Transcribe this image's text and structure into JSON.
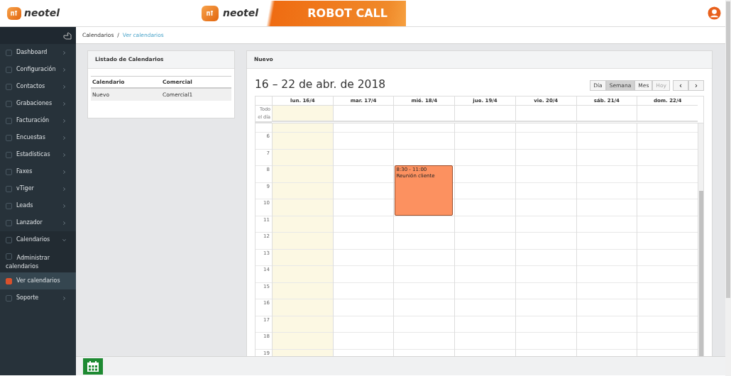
{
  "header": {
    "brand": "neotel",
    "banner": {
      "brand": "neotel",
      "title": "ROBOT CALL"
    }
  },
  "sidebar": {
    "items": [
      {
        "label": "Dashboard",
        "selected": false,
        "expanded": false
      },
      {
        "label": "Configuración",
        "selected": false,
        "expanded": false
      },
      {
        "label": "Contactos",
        "selected": false,
        "expanded": false
      },
      {
        "label": "Grabaciones",
        "selected": false,
        "expanded": false
      },
      {
        "label": "Facturación",
        "selected": false,
        "expanded": false
      },
      {
        "label": "Encuestas",
        "selected": false,
        "expanded": false
      },
      {
        "label": "Estadísticas",
        "selected": false,
        "expanded": false
      },
      {
        "label": "Faxes",
        "selected": false,
        "expanded": false
      },
      {
        "label": "vTiger",
        "selected": false,
        "expanded": false
      },
      {
        "label": "Leads",
        "selected": false,
        "expanded": false
      },
      {
        "label": "Lanzador",
        "selected": false,
        "expanded": false
      },
      {
        "label": "Calendarios",
        "selected": false,
        "expanded": true,
        "children": [
          {
            "label": "Administrar calendarios",
            "selected": false
          },
          {
            "label": "Ver calendarios",
            "selected": true
          }
        ]
      },
      {
        "label": "Soporte",
        "selected": false,
        "expanded": false
      }
    ]
  },
  "breadcrumb": {
    "items": [
      "Calendarios",
      "Ver calendarios"
    ],
    "separator": "/"
  },
  "calendar_list": {
    "title": "Listado de Calendarios",
    "columns": [
      "Calendario",
      "Comercial"
    ],
    "rows": [
      [
        "Nuevo",
        "Comercial1"
      ]
    ]
  },
  "calendar": {
    "card_title": "Nuevo",
    "range": "16 – 22 de abr. de 2018",
    "views": [
      {
        "label": "Día",
        "selected": false,
        "disabled": false
      },
      {
        "label": "Semana",
        "selected": true,
        "disabled": false
      },
      {
        "label": "Mes",
        "selected": false,
        "disabled": false
      },
      {
        "label": "Hoy",
        "selected": false,
        "disabled": true
      }
    ],
    "nav": [
      "‹",
      "›"
    ],
    "all_day_label": "Todo el día",
    "hours": [
      "6",
      "7",
      "8",
      "9",
      "10",
      "11",
      "12",
      "13",
      "14",
      "15",
      "16",
      "17",
      "18",
      "19"
    ],
    "days": [
      {
        "label": "lun. 16/4",
        "today": true
      },
      {
        "label": "mar. 17/4",
        "today": false
      },
      {
        "label": "mié. 18/4",
        "today": false,
        "events": [
          {
            "time": "8:30 - 11:00",
            "title": "Reunión cliente"
          }
        ]
      },
      {
        "label": "jue. 19/4",
        "today": false
      },
      {
        "label": "vie. 20/4",
        "today": false
      },
      {
        "label": "sáb. 21/4",
        "today": false
      },
      {
        "label": "dom. 22/4",
        "today": false
      }
    ]
  }
}
